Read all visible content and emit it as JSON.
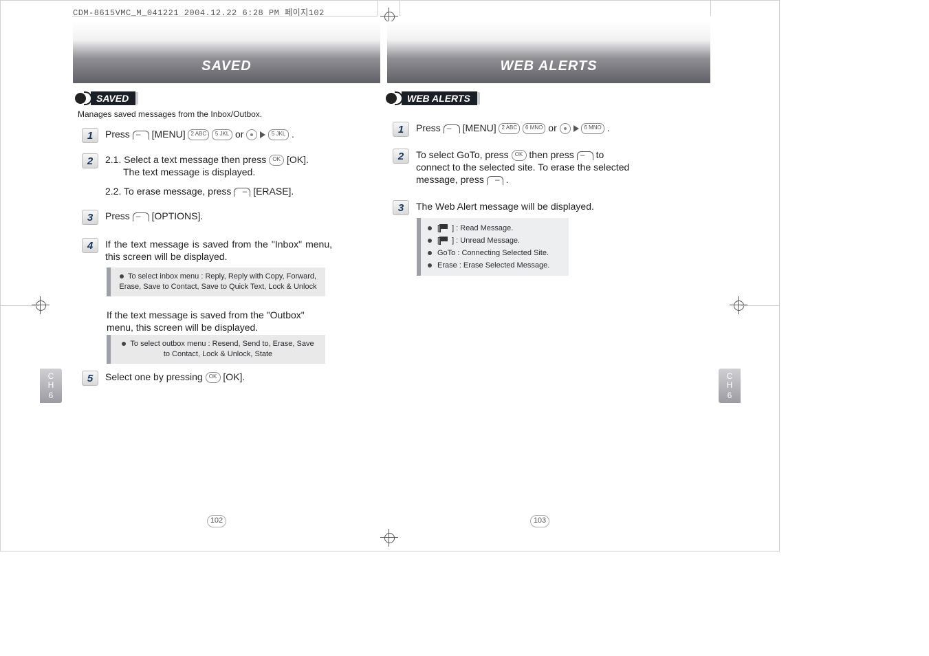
{
  "header_line": "CDM-8615VMC_M_041221  2004.12.22 6:28 PM  페이지102",
  "left": {
    "banner": "SAVED",
    "section": "SAVED",
    "subtitle": "Manages saved messages from the Inbox/Outbox.",
    "step1_a": "Press",
    "step1_b": "[MENU]",
    "step1_c": "or",
    "key_2": "2 ABC",
    "key_5": "5 JKL",
    "step2_1": "2.1. Select a text message then press",
    "step2_1b": "[OK].",
    "step2_1c": "The text message is displayed.",
    "step2_2a": "2.2. To erase message, press",
    "step2_2b": "[ERASE].",
    "step3_a": "Press",
    "step3_b": "[OPTIONS].",
    "step4": "If the text message is saved from the \"Inbox\" menu, this screen will be displayed.",
    "note4": "To select inbox menu : Reply, Reply with Copy, Forward, Erase, Save to Contact, Save to Quick Text, Lock & Unlock",
    "step4b": "If the text message is saved from the \"Outbox\" menu, this screen will be displayed.",
    "note4b": "To select outbox menu : Resend, Send to, Erase, Save to Contact, Lock & Unlock, State",
    "step5_a": "Select one by pressing",
    "step5_b": "[OK]."
  },
  "right": {
    "banner": "WEB ALERTS",
    "section": "WEB ALERTS",
    "step1_a": "Press",
    "step1_b": "[MENU]",
    "step1_c": "or",
    "key_2": "2 ABC",
    "key_6": "6 MNO",
    "step2_a": "To select GoTo, press",
    "step2_b": "then press",
    "step2_c": "to connect to the selected site.  To erase the selected message, press",
    "step3": "The Web Alert message will be displayed.",
    "info1": "] : Read Message.",
    "info2": "] : Unread Message.",
    "info3": "GoTo : Connecting Selected Site.",
    "info4": "Erase : Erase Selected Message."
  },
  "tab": {
    "line1": "C",
    "line2": "H",
    "line3": "6"
  },
  "pages": {
    "left": "102",
    "right": "103"
  }
}
